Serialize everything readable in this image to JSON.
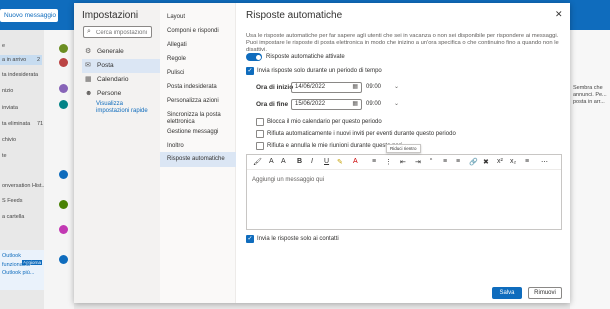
{
  "background": {
    "new_mail": "Nuovo messaggio",
    "folders": [
      {
        "label": "e",
        "count": ""
      },
      {
        "label": "a in arrivo",
        "count": "2"
      },
      {
        "label": "ta indesiderata",
        "count": ""
      },
      {
        "label": "nizio",
        "count": ""
      },
      {
        "label": "inviata",
        "count": ""
      },
      {
        "label": "ta eliminata",
        "count": "71"
      },
      {
        "label": "chivio",
        "count": ""
      },
      {
        "label": "te",
        "count": ""
      },
      {
        "label": "onversation Hist...",
        "count": ""
      },
      {
        "label": "S Feeds",
        "count": ""
      },
      {
        "label": "a cartella",
        "count": ""
      }
    ],
    "promo": [
      "Outlook",
      "funzionalità",
      "Outlook più..."
    ],
    "promo_badge": "Aggiorna",
    "right_lines": [
      "Sembra che",
      "annunci. Pe...",
      "posta in arr..."
    ]
  },
  "settings": {
    "title": "Impostazioni",
    "search_placeholder": "Cerca impostazioni",
    "nav": [
      {
        "label": "Generale",
        "icon": "gear-icon"
      },
      {
        "label": "Posta",
        "icon": "mail-icon"
      },
      {
        "label": "Calendario",
        "icon": "calendar-icon"
      },
      {
        "label": "Persone",
        "icon": "people-icon"
      }
    ],
    "quick_settings_link": "Visualizza impostazioni rapide",
    "subnav": [
      "Layout",
      "Componi e rispondi",
      "Allegati",
      "Regole",
      "Pulisci",
      "Posta indesiderata",
      "Personalizza azioni",
      "Sincronizza la posta elettronica",
      "Gestione messaggi",
      "Inoltro",
      "Risposte automatiche"
    ]
  },
  "auto_reply": {
    "title": "Risposte automatiche",
    "description": "Usa le risposte automatiche per far sapere agli utenti che sei in vacanza o non sei disponibile per rispondere ai messaggi. Puoi impostare le risposte di posta elettronica in modo che inizino a un'ora specifica o che continuino fino a quando non le disattivi.",
    "toggle_label": "Risposte automatiche attivate",
    "period_label": "Invia risposte solo durante un periodo di tempo",
    "start_label": "Ora di inizio",
    "start_date": "14/06/2022",
    "start_time": "09:00",
    "end_label": "Ora di fine",
    "end_date": "15/06/2022",
    "end_time": "09:00",
    "opt_block_calendar": "Blocca il mio calendario per questo periodo",
    "opt_decline_new": "Rifiuta automaticamente i nuovi inviti per eventi durante questo periodo",
    "opt_decline_existing": "Rifiuta e annulla le mie riunioni durante questo peri...",
    "tooltip": "Riduci rientro",
    "editor_placeholder": "Aggiungi un messaggio qui",
    "contacts_only": "Invia le risposte solo ai contatti",
    "save": "Salva",
    "cancel": "Rimuovi"
  },
  "colors": {
    "accent": "#0f6cbd",
    "header": "#0f6cbd"
  }
}
